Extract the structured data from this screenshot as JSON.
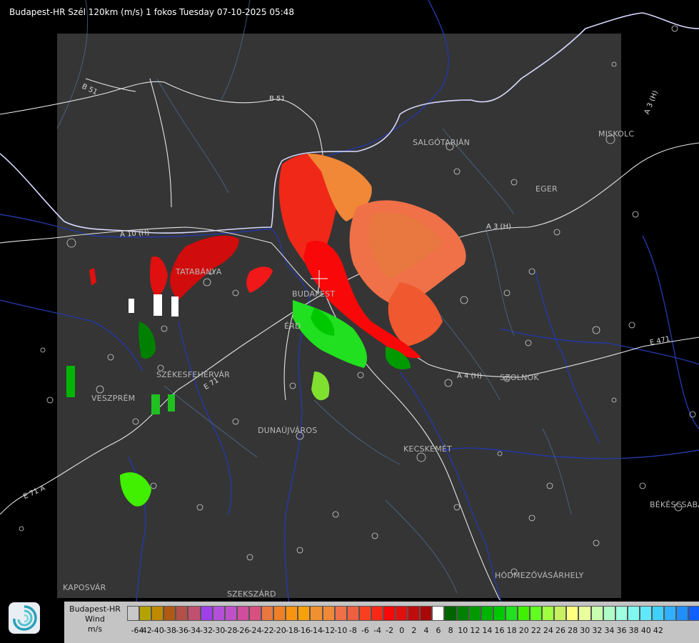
{
  "title": "Budapest-HR Szél 120km (m/s) 1 fokos Tuesday 07-10-2025 05:48",
  "cities": [
    {
      "id": "salgotarjan",
      "label": "SALGÓTARJÁN"
    },
    {
      "id": "miskolc",
      "label": "MISKOLC"
    },
    {
      "id": "eger",
      "label": "EGER"
    },
    {
      "id": "tatabanya",
      "label": "TATABÁNYA"
    },
    {
      "id": "budapest",
      "label": "BUDAPEST"
    },
    {
      "id": "erd",
      "label": "ÉRD"
    },
    {
      "id": "szekesfehervar",
      "label": "SZÉKESFEHÉRVÁR"
    },
    {
      "id": "veszprem",
      "label": "VESZPRÉM"
    },
    {
      "id": "dunaujvaros",
      "label": "DUNAÚJVÁROS"
    },
    {
      "id": "szolnok",
      "label": "SZOLNOK"
    },
    {
      "id": "kecskemet",
      "label": "KECSKEMÉT"
    },
    {
      "id": "bekescsaba",
      "label": "BÉKÉSCSABA"
    },
    {
      "id": "hodmezovasarhely",
      "label": "HÓDMEZŐVÁSÁRHELY"
    },
    {
      "id": "kaposvar",
      "label": "KAPOSVÁR"
    },
    {
      "id": "szekszard",
      "label": "SZEKSZÁRD"
    }
  ],
  "roads": [
    {
      "id": "b51a",
      "label": "B 51"
    },
    {
      "id": "b51b",
      "label": "B 51"
    },
    {
      "id": "a3",
      "label": "A 3 (H)"
    },
    {
      "id": "a3b",
      "label": "A 3 (H)"
    },
    {
      "id": "a10",
      "label": "A 10 (H)"
    },
    {
      "id": "a4",
      "label": "A 4 (H)"
    },
    {
      "id": "e71",
      "label": "E 71"
    },
    {
      "id": "e71b",
      "label": "E 71 A"
    },
    {
      "id": "e471",
      "label": "E 471"
    }
  ],
  "legend": {
    "station": "Budapest-HR",
    "product": "Wind",
    "unit": "m/s",
    "colors": [
      "#c8c8c8",
      "#b4a200",
      "#c08a00",
      "#b05a14",
      "#b4504a",
      "#c0506e",
      "#a040e8",
      "#b450d8",
      "#c050c8",
      "#d04c9c",
      "#d85080",
      "#e87840",
      "#f08028",
      "#f89410",
      "#f8a008",
      "#f09030",
      "#f08838",
      "#f07048",
      "#f06040",
      "#f84020",
      "#f82818",
      "#f80808",
      "#e01010",
      "#c00c0c",
      "#a80808",
      "#ffffff",
      "#006400",
      "#008000",
      "#009a00",
      "#00b400",
      "#00c800",
      "#20e020",
      "#40f000",
      "#60ff20",
      "#a0ff40",
      "#c8f060",
      "#ffff80",
      "#e8ff9c",
      "#c8ffb0",
      "#b0ffc8",
      "#a0ffe0",
      "#80f8f0",
      "#60e8ff",
      "#40d0ff",
      "#30b0ff",
      "#2090ff",
      "#1060ff",
      "#0820ff"
    ],
    "ticks": [
      "-64",
      "-42",
      "-40",
      "-38",
      "-36",
      "-34",
      "-32",
      "-30",
      "-28",
      "-26",
      "-24",
      "-22",
      "-20",
      "-18",
      "-16",
      "-14",
      "-12",
      "-10",
      "-8",
      "-6",
      "-4",
      "-2",
      "0",
      "2",
      "4",
      "6",
      "8",
      "10",
      "12",
      "14",
      "16",
      "18",
      "20",
      "22",
      "24",
      "26",
      "28",
      "30",
      "32",
      "34",
      "36",
      "38",
      "40",
      "42"
    ]
  }
}
